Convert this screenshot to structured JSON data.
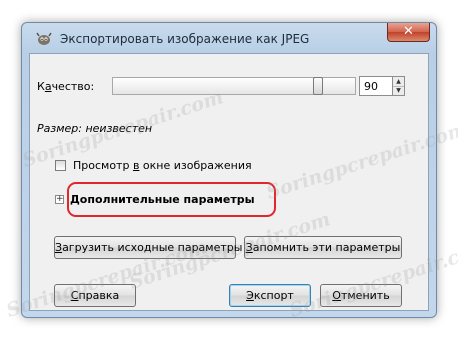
{
  "window": {
    "title": "Экспортировать изображение как JPEG",
    "close_symbol": "✕"
  },
  "quality": {
    "label_prefix": "К",
    "label_underlined": "а",
    "label_suffix": "чество:",
    "value": "90",
    "slider_fraction": 0.9
  },
  "size_text": "Размер: неизвестен",
  "preview": {
    "label_prefix": "Просмотр ",
    "label_underlined": "в",
    "label_suffix": " окне изображения",
    "checked": false
  },
  "advanced": {
    "expander_symbol": "+",
    "label_underlined": "Д",
    "label_suffix": "ополнительные параметры"
  },
  "buttons": {
    "load_defaults": {
      "underlined": "З",
      "rest": "агрузить исходные параметры"
    },
    "save_defaults": {
      "underlined": "З",
      "rest": "апомнить эти параметры"
    },
    "help": {
      "underlined": "С",
      "rest": "правка"
    },
    "export": {
      "underlined": "Э",
      "rest": "кспорт"
    },
    "cancel": {
      "underlined": "О",
      "rest": "тменить"
    }
  },
  "watermark_text": "Soringpcrepair.com",
  "colors": {
    "highlight": "#e0272e",
    "close_button": "#c2412b"
  }
}
